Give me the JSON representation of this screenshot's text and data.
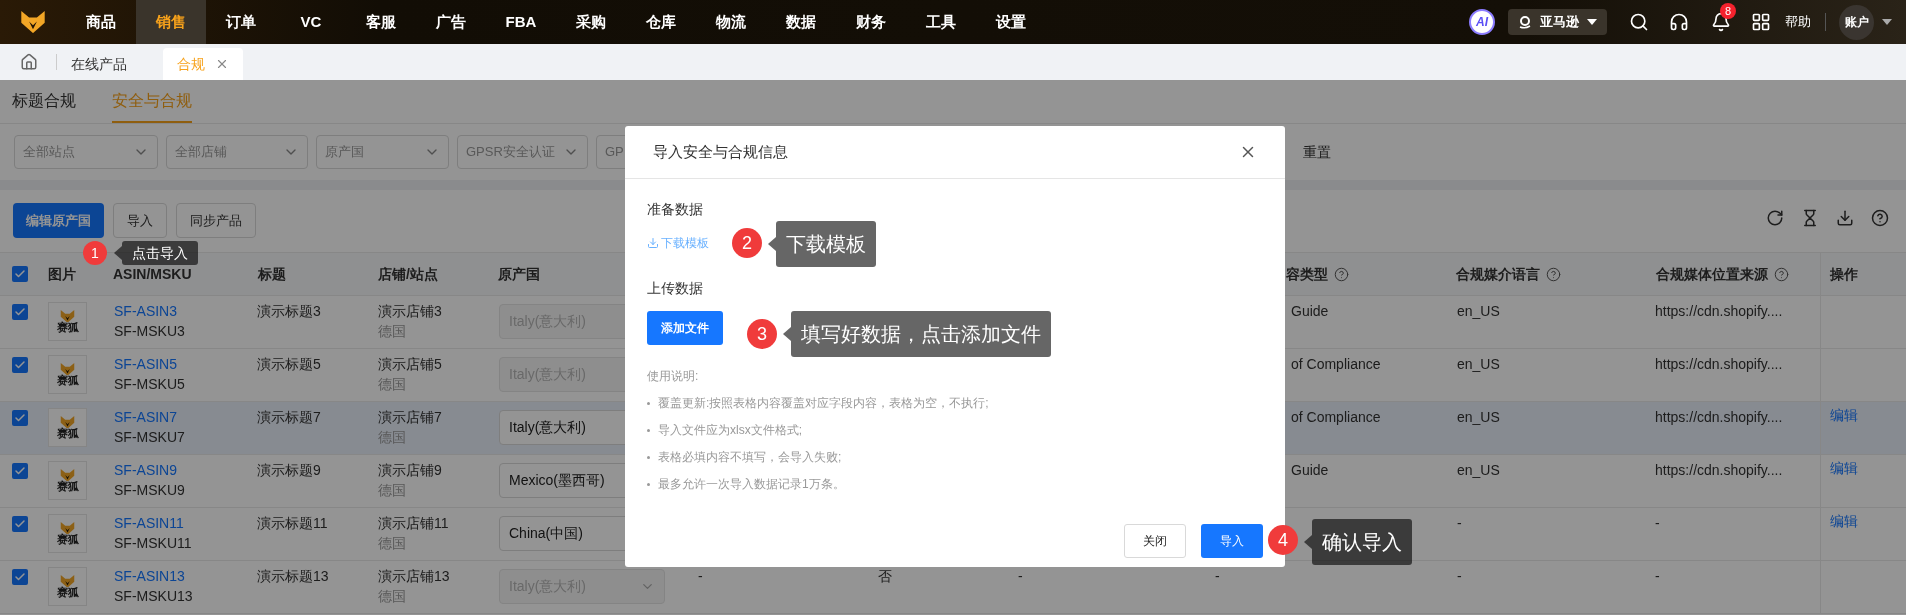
{
  "nav": {
    "items": [
      {
        "label": "商品",
        "selected": false
      },
      {
        "label": "销售",
        "selected": true
      },
      {
        "label": "订单",
        "selected": false
      },
      {
        "label": "VC",
        "selected": false
      },
      {
        "label": "客服",
        "selected": false
      },
      {
        "label": "广告",
        "selected": false
      },
      {
        "label": "FBA",
        "selected": false
      },
      {
        "label": "采购",
        "selected": false
      },
      {
        "label": "仓库",
        "selected": false
      },
      {
        "label": "物流",
        "selected": false
      },
      {
        "label": "数据",
        "selected": false
      },
      {
        "label": "财务",
        "selected": false
      },
      {
        "label": "工具",
        "selected": false
      },
      {
        "label": "设置",
        "selected": false
      }
    ],
    "ai": "AI",
    "marketplace": "亚马逊",
    "notifications": "8",
    "help": "帮助",
    "account": "账户"
  },
  "tabs": [
    {
      "label": "在线产品",
      "selected": false,
      "closable": false
    },
    {
      "label": "合规",
      "selected": true,
      "closable": true
    }
  ],
  "subtabs": [
    {
      "label": "标题合规",
      "selected": false
    },
    {
      "label": "安全与合规",
      "selected": true
    }
  ],
  "filters": [
    {
      "placeholder": "全部站点"
    },
    {
      "placeholder": "全部店铺"
    },
    {
      "placeholder": "原产国"
    },
    {
      "placeholder": "GPSR安全认证"
    },
    {
      "placeholder": "GP"
    }
  ],
  "reset": "重置",
  "toolbar": [
    {
      "label": "编辑原产国",
      "kind": "primary"
    },
    {
      "label": "导入",
      "kind": "default"
    },
    {
      "label": "同步产品",
      "kind": "default"
    }
  ],
  "table": {
    "all_checked": true,
    "columns": [
      {
        "label": "图片",
        "help": false
      },
      {
        "label": "ASIN/MSKU",
        "help": false
      },
      {
        "label": "标题",
        "help": false
      },
      {
        "label": "店铺/站点",
        "help": false
      },
      {
        "label": "原产国",
        "help": false
      },
      {
        "label": "容类型",
        "help": true
      },
      {
        "label": "合规媒介语言",
        "help": true
      },
      {
        "label": "合规媒体位置来源",
        "help": true
      },
      {
        "label": "操作",
        "help": false
      }
    ],
    "rows": [
      {
        "checked": true,
        "highlighted": false,
        "thumb_label": "赛狐",
        "asin": "SF-ASIN3",
        "msku": "SF-MSKU3",
        "title": "演示标题3",
        "store": "演示店铺3",
        "site": "德国",
        "origin": {
          "value": "Italy(意大利)",
          "disabled": true
        },
        "content_type": "Guide",
        "language": "en_US",
        "source": "https://cdn.shopify...."
      },
      {
        "checked": true,
        "highlighted": false,
        "thumb_label": "赛狐",
        "asin": "SF-ASIN5",
        "msku": "SF-MSKU5",
        "title": "演示标题5",
        "store": "演示店铺5",
        "site": "德国",
        "origin": {
          "value": "Italy(意大利)",
          "disabled": true
        },
        "content_type": "of Compliance",
        "language": "en_US",
        "source": "https://cdn.shopify...."
      },
      {
        "checked": true,
        "highlighted": true,
        "thumb_label": "赛狐",
        "asin": "SF-ASIN7",
        "msku": "SF-MSKU7",
        "title": "演示标题7",
        "store": "演示店铺7",
        "site": "德国",
        "origin": {
          "value": "Italy(意大利)",
          "disabled": false
        },
        "content_type": "of Compliance",
        "language": "en_US",
        "source": "https://cdn.shopify....",
        "action": "编辑"
      },
      {
        "checked": true,
        "highlighted": false,
        "thumb_label": "赛狐",
        "asin": "SF-ASIN9",
        "msku": "SF-MSKU9",
        "title": "演示标题9",
        "store": "演示店铺9",
        "site": "德国",
        "origin": {
          "value": "Mexico(墨西哥)",
          "disabled": false
        },
        "content_type": "Guide",
        "language": "en_US",
        "source": "https://cdn.shopify....",
        "action": "编辑"
      },
      {
        "checked": true,
        "highlighted": false,
        "thumb_label": "赛狐",
        "asin": "SF-ASIN11",
        "msku": "SF-MSKU11",
        "title": "演示标题11",
        "store": "演示店铺11",
        "site": "德国",
        "origin": {
          "value": "China(中国)",
          "disabled": false
        },
        "language": "-",
        "source": "-",
        "action": "编辑"
      },
      {
        "checked": true,
        "highlighted": false,
        "thumb_label": "赛狐",
        "asin": "SF-ASIN13",
        "msku": "SF-MSKU13",
        "title": "演示标题13",
        "store": "演示店铺13",
        "site": "德国",
        "origin": {
          "value": "Italy(意大利)",
          "disabled": true
        },
        "hidden_cells": [
          "-",
          "否",
          "-"
        ],
        "content_type": "-",
        "language": "-",
        "source": "-"
      }
    ]
  },
  "dialog": {
    "title": "导入安全与合规信息",
    "prepare_heading": "准备数据",
    "download_link": "下载模板",
    "upload_heading": "上传数据",
    "add_file_button": "添加文件",
    "instructions_title": "使用说明:",
    "instructions": [
      "覆盖更新:按照表格内容覆盖对应字段内容，表格为空，不执行;",
      "导入文件应为xlsx文件格式;",
      "表格必填内容不填写，会导入失败;",
      "最多允许一次导入数据记录1万条。"
    ],
    "buttons": [
      {
        "label": "关闭",
        "kind": "default"
      },
      {
        "label": "导入",
        "kind": "primary"
      }
    ]
  },
  "annotations": [
    {
      "number": "1",
      "text": "点击导入"
    },
    {
      "number": "2",
      "text": "下载模板"
    },
    {
      "number": "3",
      "text": "填写好数据，点击添加文件"
    },
    {
      "number": "4",
      "text": "确认导入"
    }
  ]
}
